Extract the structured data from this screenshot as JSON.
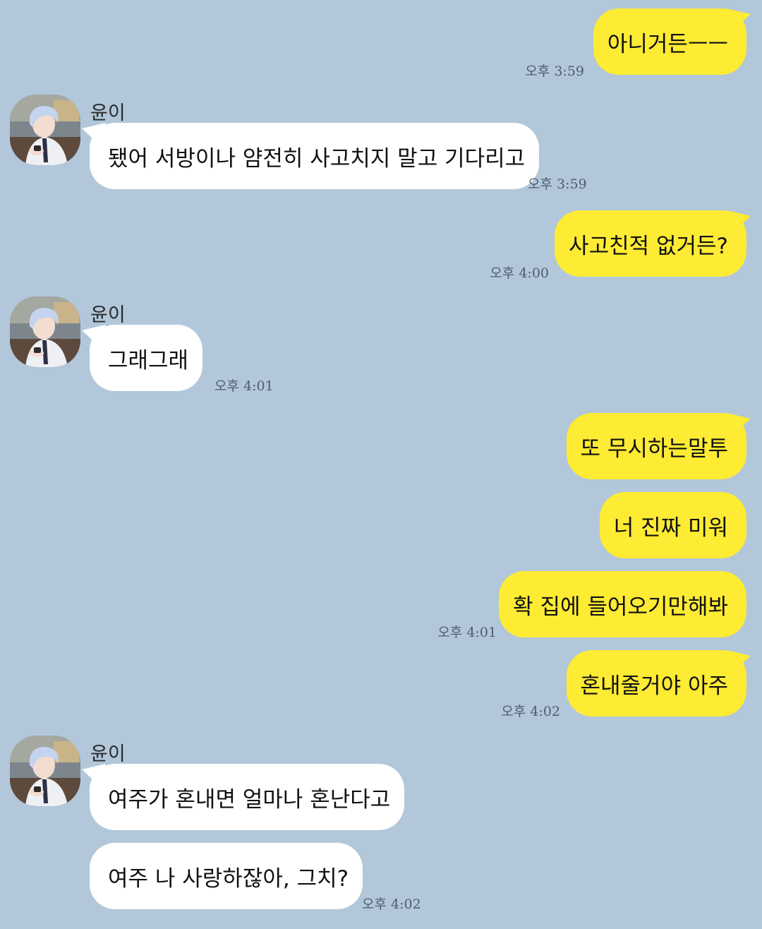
{
  "contact": {
    "name": "윤이"
  },
  "messages": [
    {
      "id": "m1",
      "side": "out",
      "text": "아니거든ㅡㅡ",
      "time": "오후 3:59"
    },
    {
      "id": "m2",
      "side": "in",
      "text": "됐어 서방이나 얌전히 사고치지 말고 기다리고",
      "time": "오후 3:59"
    },
    {
      "id": "m3",
      "side": "out",
      "text": "사고친적 없거든?",
      "time": "오후 4:00"
    },
    {
      "id": "m4",
      "side": "in",
      "text": "그래그래",
      "time": "오후 4:01"
    },
    {
      "id": "m5",
      "side": "out",
      "text": "또 무시하는말투",
      "time": ""
    },
    {
      "id": "m6",
      "side": "out",
      "text": "너 진짜 미워",
      "time": ""
    },
    {
      "id": "m7",
      "side": "out",
      "text": "확 집에 들어오기만해봐",
      "time": "오후 4:01"
    },
    {
      "id": "m8",
      "side": "out",
      "text": "혼내줄거야 아주",
      "time": "오후 4:02"
    },
    {
      "id": "m9",
      "side": "in",
      "text": "여주가 혼내면 얼마나 혼난다고",
      "time": ""
    },
    {
      "id": "m10",
      "side": "in",
      "text": "여주 나 사랑하잖아, 그치?",
      "time": "오후 4:02"
    }
  ],
  "colors": {
    "background": "#b2c7da",
    "outgoing_bubble": "#fdeb34",
    "incoming_bubble": "#ffffff",
    "timestamp": "#4f5d69"
  }
}
